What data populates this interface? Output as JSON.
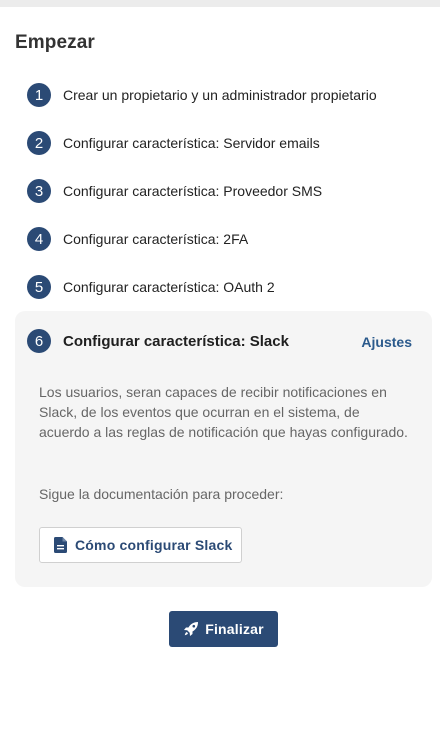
{
  "page": {
    "title": "Empezar"
  },
  "steps": [
    {
      "number": "1",
      "label": "Crear un propietario y un administrador propietario"
    },
    {
      "number": "2",
      "label": "Configurar característica: Servidor emails"
    },
    {
      "number": "3",
      "label": "Configurar característica: Proveedor SMS"
    },
    {
      "number": "4",
      "label": "Configurar característica: 2FA"
    },
    {
      "number": "5",
      "label": "Configurar característica: OAuth 2"
    }
  ],
  "active_step": {
    "number": "6",
    "label": "Configurar característica: Slack",
    "settings_link": "Ajustes",
    "description": "Los usuarios, seran capaces de recibir notificaciones en Slack, de los eventos que ocurran en el sistema, de acuerdo a las reglas de notificación que hayas configurado.",
    "follow_text": "Sigue la documentación para proceder:",
    "doc_button": {
      "label": "Cómo configurar Slack",
      "icon": "document-icon"
    }
  },
  "finish_button": {
    "label": "Finalizar",
    "icon": "rocket-icon"
  },
  "colors": {
    "primary": "#2b4a75",
    "link": "#2b5a8c",
    "panel_bg": "#f5f5f5",
    "muted_text": "#666666"
  }
}
